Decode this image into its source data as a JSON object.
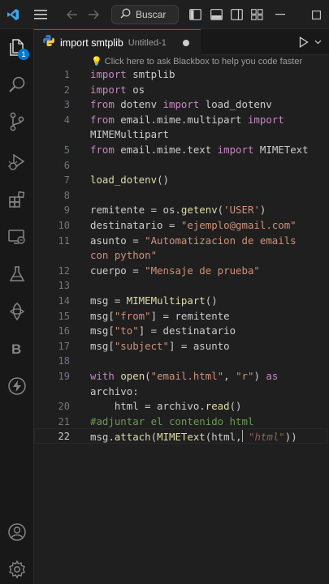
{
  "titlebar": {
    "search_label": "Buscar"
  },
  "activity": {
    "explorer_badge": "1"
  },
  "tab": {
    "name": "import smtplib",
    "description": "Untitled-1"
  },
  "editor": {
    "hint": "Click here to ask Blackbox to help you code faster",
    "active_line": 22,
    "lines": [
      {
        "n": "1",
        "html": "<span class=\"k\">import</span> smtplib"
      },
      {
        "n": "2",
        "html": "<span class=\"k\">import</span> os"
      },
      {
        "n": "3",
        "html": "<span class=\"k\">from</span> dotenv <span class=\"k\">import</span> load_dotenv"
      },
      {
        "n": "4",
        "html": "<span class=\"k\">from</span> email.mime.multipart <span class=\"k\">import</span>"
      },
      {
        "n": "",
        "html": "MIMEMultipart"
      },
      {
        "n": "5",
        "html": "<span class=\"k\">from</span> email.mime.text <span class=\"k\">import</span> MIMEText"
      },
      {
        "n": "6",
        "html": ""
      },
      {
        "n": "7",
        "html": "<span class=\"f\">load_dotenv</span>()"
      },
      {
        "n": "8",
        "html": ""
      },
      {
        "n": "9",
        "html": "remitente = os.<span class=\"f\">getenv</span>(<span class=\"s\">'USER'</span>)"
      },
      {
        "n": "10",
        "html": "destinatario = <span class=\"s\">\"ejemplo@gmail.com\"</span>"
      },
      {
        "n": "11",
        "html": "asunto = <span class=\"s\">\"Automatizacion de emails</span>"
      },
      {
        "n": "",
        "html": "<span class=\"s\">con python\"</span>"
      },
      {
        "n": "12",
        "html": "cuerpo = <span class=\"s\">\"Mensaje de prueba\"</span>"
      },
      {
        "n": "13",
        "html": ""
      },
      {
        "n": "14",
        "html": "msg = <span class=\"f\">MIMEMultipart</span>()"
      },
      {
        "n": "15",
        "html": "msg[<span class=\"s\">\"from\"</span>] = remitente"
      },
      {
        "n": "16",
        "html": "msg[<span class=\"s\">\"to\"</span>] = destinatario"
      },
      {
        "n": "17",
        "html": "msg[<span class=\"s\">\"subject\"</span>] = asunto"
      },
      {
        "n": "18",
        "html": ""
      },
      {
        "n": "19",
        "html": "<span class=\"k\">with</span> <span class=\"f\">open</span>(<span class=\"s\">\"email.html\"</span>, <span class=\"s\">\"r\"</span>) <span class=\"k\">as</span>"
      },
      {
        "n": "",
        "html": "archivo:"
      },
      {
        "n": "20",
        "html": "    html = archivo.<span class=\"f\">read</span>()"
      },
      {
        "n": "21",
        "html": "<span class=\"c\">#adjuntar el contenido html</span>"
      },
      {
        "n": "22",
        "html": "msg.<span class=\"f\">attach</span>(<span class=\"f\">MIMEText</span>(html,<span class=\"cursor\"></span> <span class=\"it\">\"html\"</span>))"
      }
    ]
  }
}
